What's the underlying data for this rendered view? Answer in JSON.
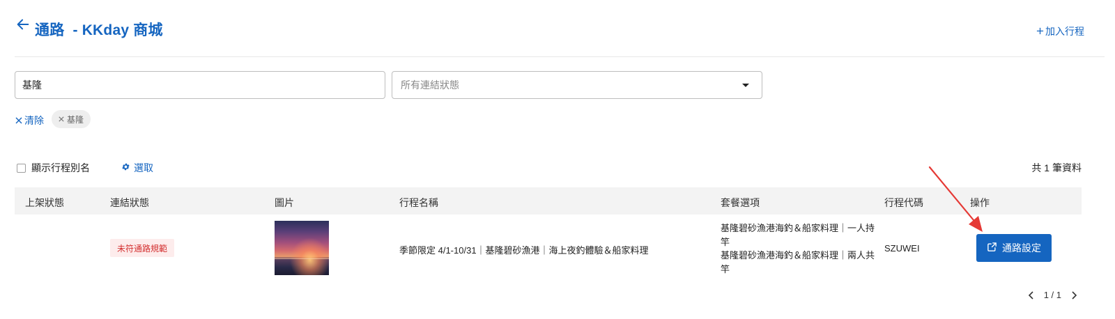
{
  "header": {
    "title": "通路  - KKday 商城",
    "add_trip_label": "加入行程"
  },
  "filters": {
    "search_value": "基隆",
    "status_placeholder": "所有連結狀態",
    "clear_label": "清除",
    "chip_label": "基隆"
  },
  "toolbar": {
    "show_alias_label": "顯示行程別名",
    "select_columns_label": "選取",
    "total_count": "共 1 筆資料"
  },
  "table": {
    "columns": [
      "上架狀態",
      "連結狀態",
      "圖片",
      "行程名稱",
      "套餐選項",
      "行程代碼",
      "操作"
    ],
    "rows": [
      {
        "listing_status": "",
        "link_status": "未符通路規範",
        "trip_name": "季節限定 4/1-10/31｜基隆碧砂漁港｜海上夜釣體驗＆船家料理",
        "package_options": [
          "基隆碧砂漁港海釣＆船家料理｜一人持竿",
          "基隆碧砂漁港海釣＆船家料理｜兩人共竿"
        ],
        "trip_code": "SZUWEI",
        "action_label": "通路設定"
      }
    ]
  },
  "pagination": {
    "page_info": "1 / 1"
  },
  "colors": {
    "primary": "#1565c0",
    "badge_text": "#d32f2f",
    "badge_bg": "#fdecec",
    "annotation": "#e53935"
  },
  "icons": {
    "back": "arrow-left-icon",
    "add": "plus-icon",
    "clear": "close-icon",
    "chip_remove": "close-icon",
    "settings": "gear-icon",
    "dropdown": "caret-down-icon",
    "external": "external-link-icon",
    "prev": "chevron-left-icon",
    "next": "chevron-right-icon"
  }
}
